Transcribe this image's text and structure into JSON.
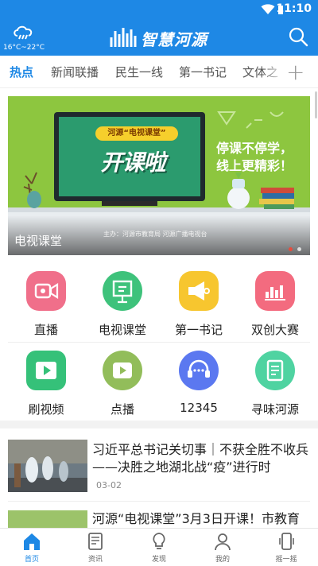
{
  "status_bar": {
    "time": "11:10"
  },
  "header": {
    "weather_temp": "16°C~22°C",
    "app_title": "智慧河源",
    "icons": [
      "cloud-rain-icon",
      "logo-mark-icon",
      "search-icon"
    ]
  },
  "tabs": [
    {
      "label": "热点",
      "active": true
    },
    {
      "label": "新闻联播",
      "active": false
    },
    {
      "label": "民生一线",
      "active": false
    },
    {
      "label": "第一书记",
      "active": false
    },
    {
      "label": "文体之",
      "active": false
    }
  ],
  "add_tab_label": "+",
  "banner": {
    "caption": "电视课堂",
    "tv_badge": "河源“电视课堂”",
    "tv_title": "开课啦",
    "slogan_line1": "停课不停学，",
    "slogan_line2": "线上更精彩！",
    "sponsor": "主办：河源市教育局  河源广播电视台",
    "slide_count": 2,
    "active_slide": 1
  },
  "quick_grid": [
    {
      "label": "直播",
      "icon": "video-camera-icon",
      "color": "#f06f8a"
    },
    {
      "label": "电视课堂",
      "icon": "easel-icon",
      "color": "#3ec27b"
    },
    {
      "label": "第一书记",
      "icon": "megaphone-icon",
      "color": "#f7c62f"
    },
    {
      "label": "双创大赛",
      "icon": "bar-chart-icon",
      "color": "#f36b7f"
    },
    {
      "label": "刷视频",
      "icon": "play-icon",
      "color": "#35c179"
    },
    {
      "label": "点播",
      "icon": "play-circle-icon",
      "color": "#92bd5a"
    },
    {
      "label": "12345",
      "icon": "headset-icon",
      "color": "#5b78f0"
    },
    {
      "label": "寻味河源",
      "icon": "notebook-icon",
      "color": "#4fd3a1"
    }
  ],
  "news": [
    {
      "title": "习近平总书记关切事｜不获全胜不收兵——决胜之地湖北战“疫”进行时",
      "date": "03-02"
    },
    {
      "title": "河源“电视课堂”3月3日开课！市教育",
      "date": ""
    }
  ],
  "bottom_nav": [
    {
      "label": "首页",
      "icon": "home-icon",
      "active": true
    },
    {
      "label": "资讯",
      "icon": "news-icon",
      "active": false
    },
    {
      "label": "发现",
      "icon": "lightbulb-icon",
      "active": false
    },
    {
      "label": "我的",
      "icon": "person-icon",
      "active": false
    },
    {
      "label": "摇一摇",
      "icon": "phone-shake-icon",
      "active": false
    }
  ],
  "colors": {
    "brand": "#1e88e5",
    "banner_bg": "#8dc63f"
  }
}
